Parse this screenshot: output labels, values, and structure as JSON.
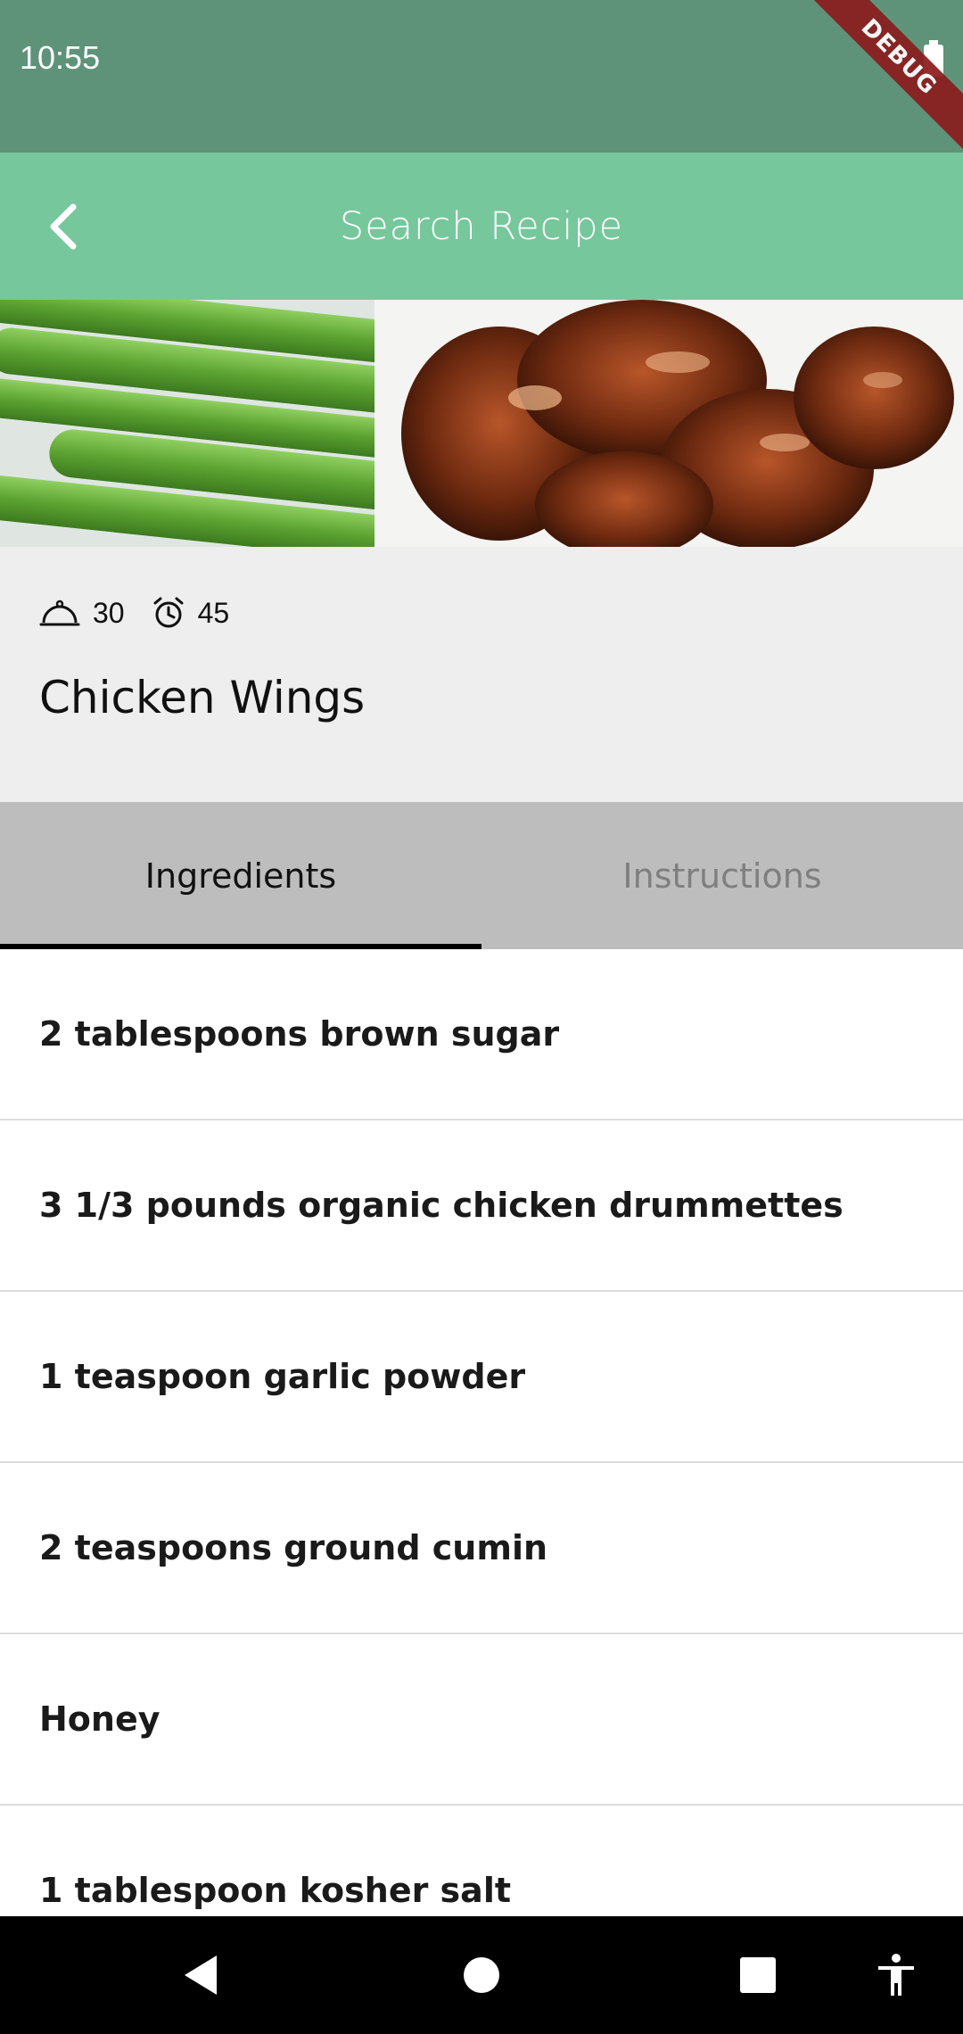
{
  "status_bar": {
    "time": "10:55",
    "debug_label": "DEBUG"
  },
  "app_bar": {
    "title": "Search Recipe"
  },
  "recipe": {
    "servings": "30",
    "ready_minutes": "45",
    "title": "Chicken Wings"
  },
  "tabs": [
    {
      "label": "Ingredients",
      "active": true
    },
    {
      "label": "Instructions",
      "active": false
    }
  ],
  "ingredients": [
    "2 tablespoons brown sugar",
    "3 1/3 pounds organic chicken drummettes",
    "1 teaspoon garlic powder",
    "2 teaspoons ground cumin",
    "Honey",
    "1 tablespoon kosher salt"
  ],
  "colors": {
    "status_bar": "#5e937a",
    "app_bar": "#77c79c",
    "tab_bar": "#bdbdbd",
    "info_panel": "#eeeeee"
  }
}
